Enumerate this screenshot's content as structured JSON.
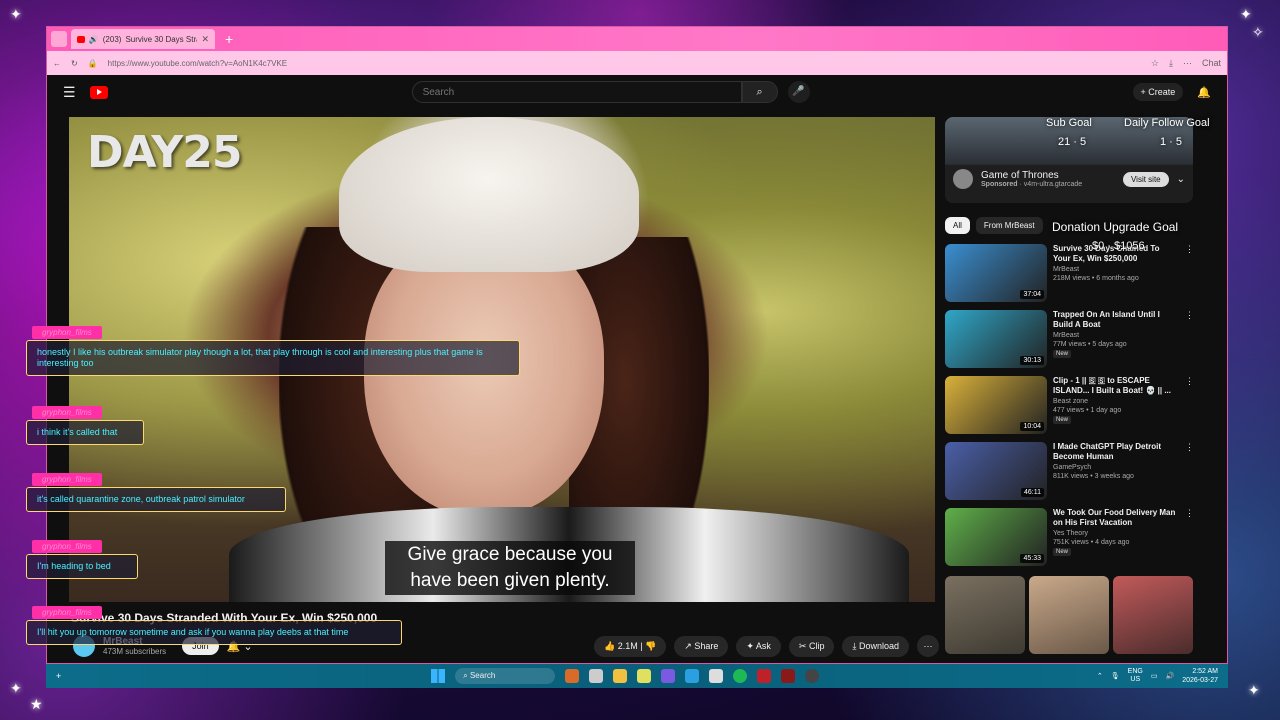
{
  "browser": {
    "tab_count": "(203)",
    "tab_title": "Survive 30 Days Strandec",
    "url": "https://www.youtube.com/watch?v=AoN1K4c7VKE",
    "chat_label": "Chat"
  },
  "header": {
    "search_placeholder": "Search",
    "create_label": "Create"
  },
  "video": {
    "overlay_text": "DAY25",
    "subtitle_line1": "Give grace because you",
    "subtitle_line2": "have been given plenty.",
    "title": "Survive 30 Days Stranded With Your Ex, Win $250,000",
    "channel": "MrBeast",
    "subscribers": "473M subscribers",
    "join_label": "Join",
    "likes": "2.1M",
    "share_label": "Share",
    "ask_label": "Ask",
    "clip_label": "Clip",
    "download_label": "Download"
  },
  "sidebar": {
    "ad": {
      "title": "Game of Thrones",
      "sponsored": "Sponsored",
      "domain": "v4m-ultra.gtarcade",
      "visit_label": "Visit site"
    },
    "chips": [
      "All",
      "From MrBeast"
    ],
    "recommendations": [
      {
        "title": "Survive 30 Days Chained To Your Ex, Win $250,000",
        "channel": "MrBeast",
        "stats": "218M views • 6 months ago",
        "duration": "37:04",
        "is_new": false,
        "thumb_color": "#3a8fd1"
      },
      {
        "title": "Trapped On An Island Until I Build A Boat",
        "channel": "MrBeast",
        "stats": "77M views • 5 days ago",
        "duration": "30:13",
        "is_new": true,
        "thumb_color": "#2fa7c9"
      },
      {
        "title": "Clip - 1 || 🇸 🇸 to ESCAPE ISLAND... I Built a Boat! 💀 || ...",
        "channel": "Beast zone",
        "stats": "477 views • 1 day ago",
        "duration": "10:04",
        "is_new": true,
        "thumb_color": "#d9b13a"
      },
      {
        "title": "I Made ChatGPT Play Detroit Become Human",
        "channel": "GamePsych",
        "stats": "811K views • 3 weeks ago",
        "duration": "46:11",
        "is_new": false,
        "thumb_color": "#4a5fa8"
      },
      {
        "title": "We Took Our Food Delivery Man on His First Vacation",
        "channel": "Yes Theory",
        "stats": "751K views • 4 days ago",
        "duration": "45:33",
        "is_new": true,
        "thumb_color": "#5fb04a"
      }
    ],
    "new_label": "New"
  },
  "chat": [
    {
      "user": "gryphon_films",
      "message": "honestly I like his outbreak simulator play though a lot, that play through is cool and interesting plus that game is interesting too"
    },
    {
      "user": "gryphon_films",
      "message": "i think it's called that"
    },
    {
      "user": "gryphon_films",
      "message": "it's called quarantine zone, outbreak patrol simulator"
    },
    {
      "user": "gryphon_films",
      "message": "I'm heading to bed"
    },
    {
      "user": "gryphon_films",
      "message": "I'll hit you up tomorrow sometime and ask if you wanna play deebs at that time"
    }
  ],
  "overlays": {
    "sub_goal": "Sub Goal",
    "daily_follow_goal": "Daily Follow Goal",
    "sub_goal_value": "21 · 5",
    "follow_goal_value": "1 · 5",
    "donation_goal": "Donation Upgrade Goal",
    "donation_value": "$0 · $1056"
  },
  "taskbar": {
    "search_label": "Search",
    "lang": "ENG",
    "region": "US",
    "time": "2:52 AM",
    "date": "2026-03-27"
  }
}
